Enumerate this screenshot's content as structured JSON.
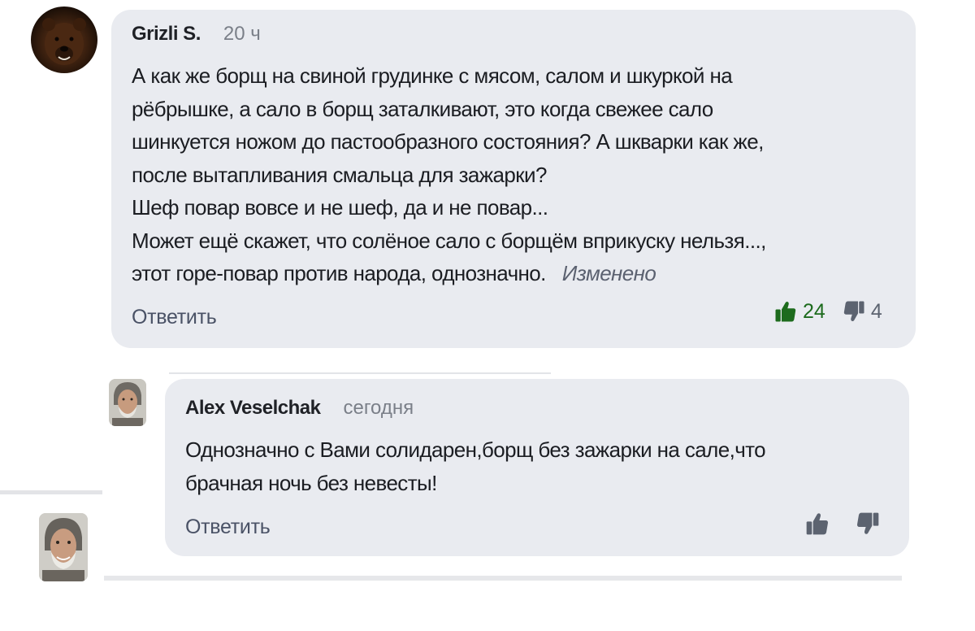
{
  "comment": {
    "author": "Grizli S.",
    "time": "20 ч",
    "lines": [
      "А как же борщ на свиной грудинке с мясом, салом и шкуркой на",
      "рёбрышке, а  сало в борщ заталкивают, это когда свежее сало",
      "шинкуется ножом до пастообразного состояния? А шкварки как же,",
      "после вытапливания смальца для зажарки?",
      "Шеф повар вовсе и не шеф, да и не повар...",
      "Может ещё скажет, что солёное сало с борщём вприкуску нельзя...,",
      "этот горе-повар против народа, однозначно."
    ],
    "edited_label": "Изменено",
    "reply_label": "Ответить",
    "likes": "24",
    "dislikes": "4"
  },
  "reply": {
    "author": "Alex Veselchak",
    "time": "сегодня",
    "lines": [
      "Однозначно с Вами солидарен,борщ без зажарки на сале,что",
      "брачная ночь без невесты!"
    ],
    "reply_label": "Ответить"
  },
  "colors": {
    "bubble": "#e9ebf0",
    "like_active": "#1d6b1d",
    "dislike": "#5c6370"
  },
  "icons": {
    "like": "thumbs-up-icon",
    "dislike": "thumbs-down-icon"
  }
}
